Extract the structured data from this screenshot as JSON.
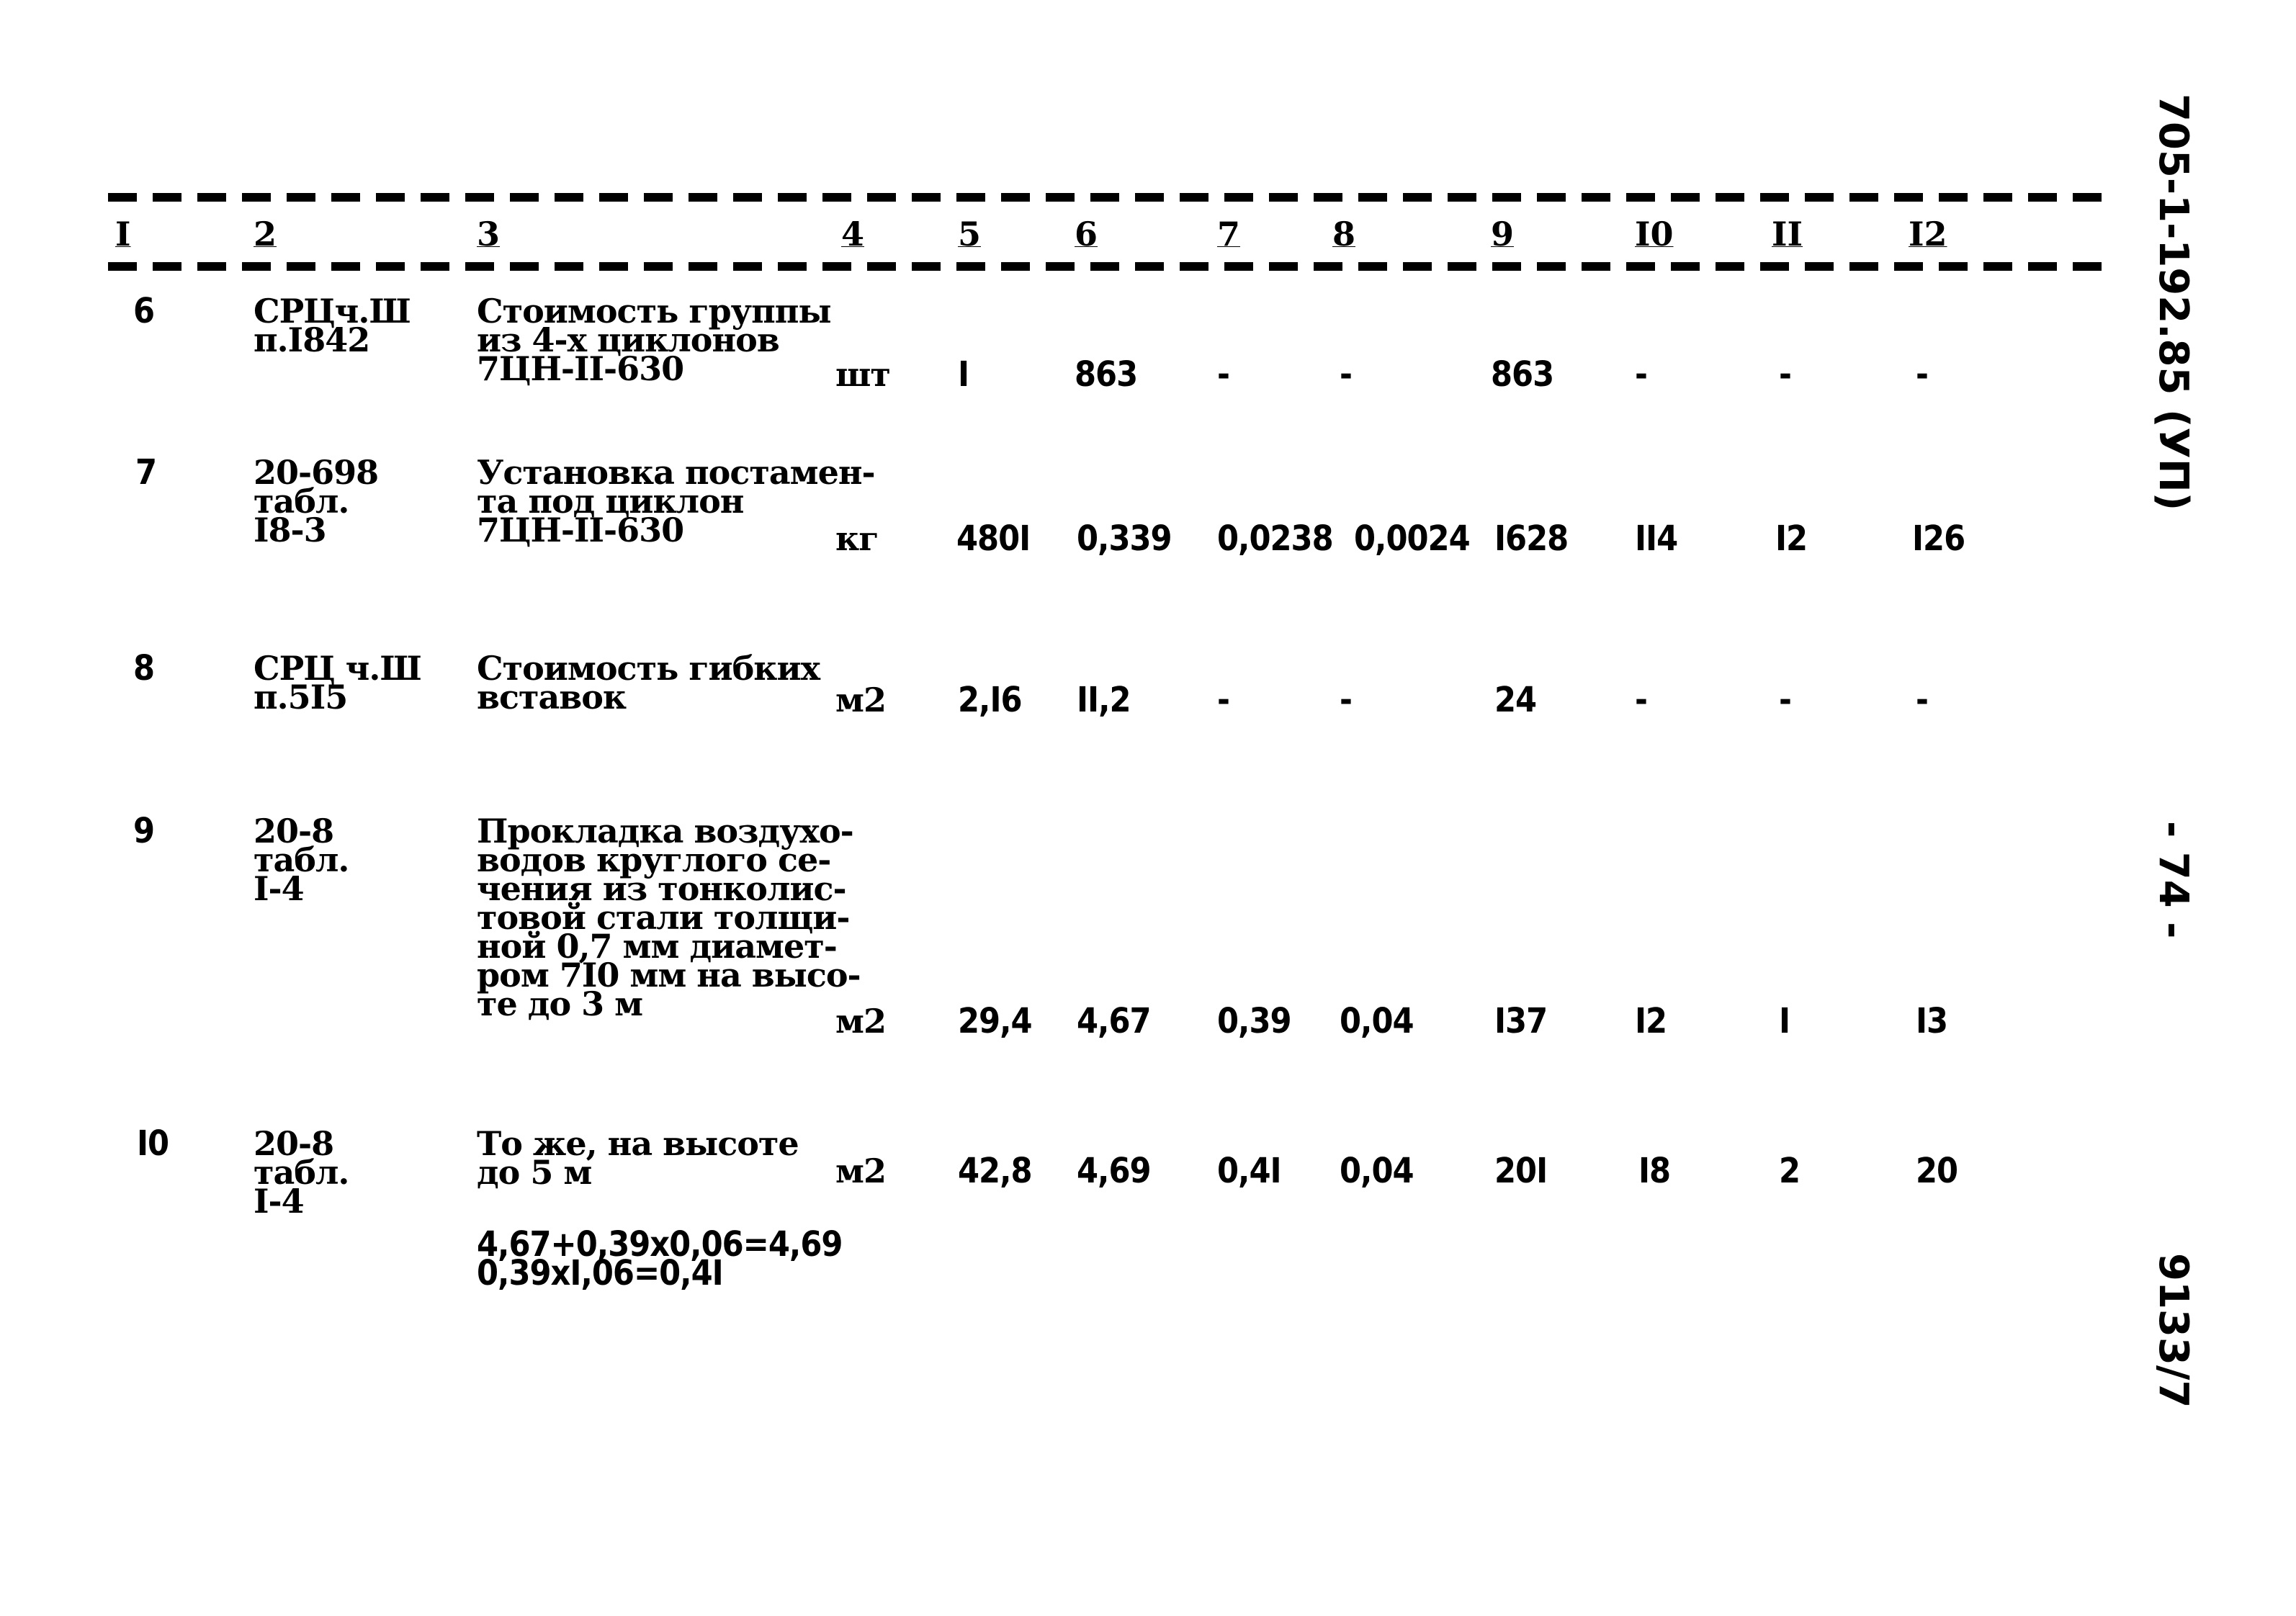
{
  "document": {
    "side_code": "705-1-192.85 (УП)",
    "page_number": "- 74 -",
    "sheet_number": "9133/7"
  },
  "table": {
    "column_headers": [
      "I",
      "2",
      "3",
      "4",
      "5",
      "6",
      "7",
      "8",
      "9",
      "I0",
      "II",
      "I2"
    ],
    "rows": [
      {
        "no": "6",
        "ref": "СРЦч.Ш\nп.I842",
        "desc": "Стоимость группы\nиз 4-х циклонов\n7ЦН-II-630",
        "unit": "шт",
        "c5": "I",
        "c6": "863",
        "c7": "-",
        "c8": "-",
        "c9": "863",
        "c10": "-",
        "c11": "-",
        "c12": "-"
      },
      {
        "no": "7",
        "ref": "20-698\nтабл.\nI8-3",
        "desc": "Установка постамен-\nта под циклон\n7ЦН-II-630",
        "unit": "кг",
        "c5": "480I",
        "c6": "0,339",
        "c7": "0,0238",
        "c8": "0,0024",
        "c9": "I628",
        "c10": "II4",
        "c11": "I2",
        "c12": "I26"
      },
      {
        "no": "8",
        "ref": "СРЦ ч.Ш\nп.5I5",
        "desc": "Стоимость гибких\nвставок",
        "unit": "м2",
        "c5": "2,I6",
        "c6": "II,2",
        "c7": "-",
        "c8": "-",
        "c9": "24",
        "c10": "-",
        "c11": "-",
        "c12": "-"
      },
      {
        "no": "9",
        "ref": "20-8\nтабл.\nI-4",
        "desc": "Прокладка воздухо-\nводов круглого се-\nчения из тонколис-\nтовой стали толщи-\nной 0,7 мм диамет-\nром 7I0 мм на высо-\nте до 3 м",
        "unit": "м2",
        "c5": "29,4",
        "c6": "4,67",
        "c7": "0,39",
        "c8": "0,04",
        "c9": "I37",
        "c10": "I2",
        "c11": "I",
        "c12": "I3"
      },
      {
        "no": "I0",
        "ref": "20-8\nтабл.\nI-4",
        "desc": "То же, на высоте\nдо 5 м",
        "unit": "м2",
        "c5": "42,8",
        "c6": "4,69",
        "c7": "0,4I",
        "c8": "0,04",
        "c9": "20I",
        "c10": "I8",
        "c11": "2",
        "c12": "20",
        "note": "4,67+0,39x0,06=4,69\n0,39xI,06=0,4I"
      }
    ]
  }
}
